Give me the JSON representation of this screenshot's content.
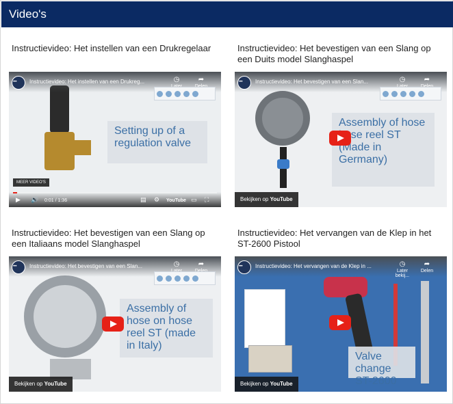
{
  "header": {
    "title": "Video's"
  },
  "videos": [
    {
      "card_title": "Instructievideo: Het instellen van een Drukregelaar",
      "overlay_title": "Instructievideo: Het instellen van een Drukreg...",
      "caption": "Setting up of a regulation valve",
      "watch_later": "Later bekij...",
      "share": "Delen",
      "meer": "MEER VIDEO'S",
      "time": "0:01 / 1:36",
      "youtube": "YouTube",
      "progress": 0.02
    },
    {
      "card_title": "Instructievideo: Het bevestigen van een Slang op een Duits model Slanghaspel",
      "overlay_title": "Instructievideo: Het bevestigen van een Slan...",
      "caption": "Assembly of hose hose reel ST (Made in Germany)",
      "watch_later": "Later bekij...",
      "share": "Delen",
      "badge_prefix": "Bekijken op",
      "youtube": "YouTube"
    },
    {
      "card_title": "Instructievideo: Het bevestigen van een Slang op een Italiaans model Slanghaspel",
      "overlay_title": "Instructievideo: Het bevestigen van een Slan...",
      "caption": "Assembly of hose on hose reel ST (made in Italy)",
      "watch_later": "Later bekij...",
      "share": "Delen",
      "badge_prefix": "Bekijken op",
      "youtube": "YouTube"
    },
    {
      "card_title": "Instructievideo: Het vervangen van de Klep in het ST-2600 Pistool",
      "overlay_title": "Instructievideo: Het vervangen van de Klep in ...",
      "caption": "Valve change ST-2600",
      "watch_later": "Later bekij...",
      "share": "Delen",
      "badge_prefix": "Bekijken op",
      "youtube": "YouTube"
    }
  ]
}
